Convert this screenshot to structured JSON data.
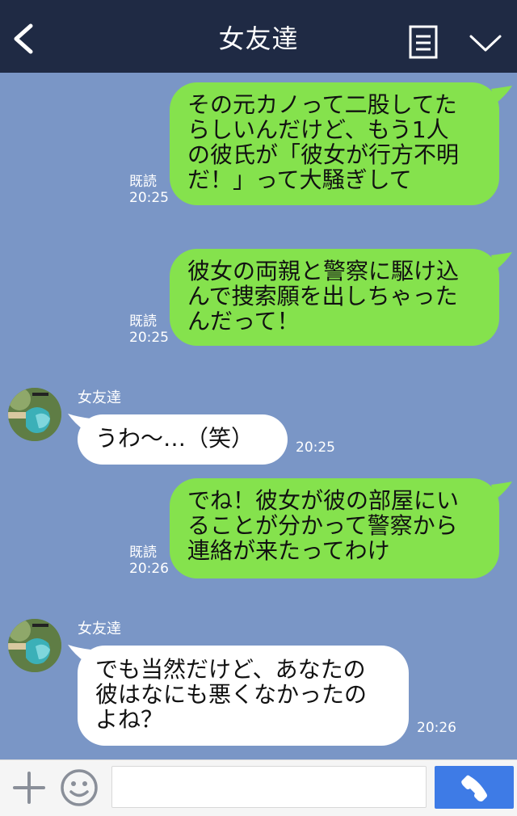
{
  "header": {
    "title": "女友達"
  },
  "messages": [
    {
      "text": "その元カノって二股してた\nらしいんだけど、もう1人\nの彼氏が「彼女が行方不明\nだ！」って大騒ぎして",
      "read": "既読",
      "time": "20:25"
    },
    {
      "text": "彼女の両親と警察に駆け込\nんで捜索願を出しちゃった\nんだって！",
      "read": "既読",
      "time": "20:25"
    },
    {
      "sender": "女友達",
      "text": "うわ〜…（笑）",
      "time": "20:25"
    },
    {
      "text": "でね！彼女が彼の部屋にい\nることが分かって警察から\n連絡が来たってわけ",
      "read": "既読",
      "time": "20:26"
    },
    {
      "sender": "女友達",
      "text": "でも当然だけど、あなたの\n彼はなにも悪くなかったの\nよね？",
      "time": "20:26"
    }
  ],
  "input": {
    "placeholder": ""
  },
  "colors": {
    "header_bg": "#1f2a44",
    "chat_bg": "#7a96c6",
    "outgoing_bubble": "#85e24d",
    "incoming_bubble": "#ffffff",
    "call_button": "#3e7be6"
  }
}
